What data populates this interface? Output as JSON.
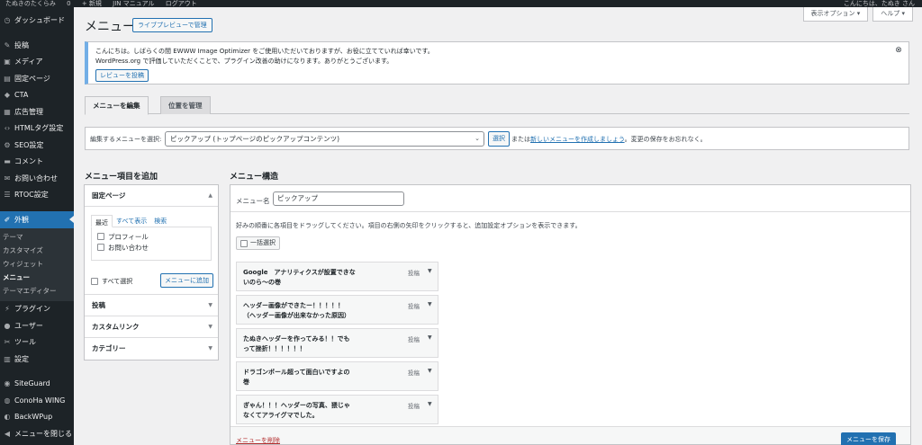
{
  "adminbar": {
    "items": [
      "たぬきのたくらみ",
      "0",
      "+ 新規",
      "JIN マニュアル",
      "ログアウト"
    ],
    "greeting": "こんにちは、たぬき さん"
  },
  "sidebar": {
    "dashboard": "ダッシュボード",
    "items": [
      {
        "label": "投稿",
        "icon": "pin-icon",
        "glyph": "✎"
      },
      {
        "label": "メディア",
        "icon": "media-icon",
        "glyph": "▣"
      },
      {
        "label": "固定ページ",
        "icon": "page-icon",
        "glyph": "▤"
      },
      {
        "label": "CTA",
        "icon": "cta-icon",
        "glyph": "◆"
      },
      {
        "label": "広告管理",
        "icon": "ads-icon",
        "glyph": "▦"
      },
      {
        "label": "HTMLタグ設定",
        "icon": "code-icon",
        "glyph": "‹›"
      },
      {
        "label": "SEO設定",
        "icon": "gear-icon",
        "glyph": "⚙"
      },
      {
        "label": "コメント",
        "icon": "comment-icon",
        "glyph": "▬"
      },
      {
        "label": "お問い合わせ",
        "icon": "mail-icon",
        "glyph": "✉"
      },
      {
        "label": "RTOC設定",
        "icon": "list-icon",
        "glyph": "☰"
      }
    ],
    "appearance": "外観",
    "sub_items": [
      "テーマ",
      "カスタマイズ",
      "ウィジェット",
      "メニュー",
      "テーマエディター"
    ],
    "items2": [
      {
        "label": "プラグイン",
        "icon": "plugin-icon",
        "glyph": "⚡"
      },
      {
        "label": "ユーザー",
        "icon": "user-icon",
        "glyph": "●"
      },
      {
        "label": "ツール",
        "icon": "tool-icon",
        "glyph": "✂"
      },
      {
        "label": "設定",
        "icon": "settings-icon",
        "glyph": "▥"
      }
    ],
    "items3": [
      {
        "label": "SiteGuard",
        "icon": "siteguard-icon",
        "glyph": "◉"
      },
      {
        "label": "ConoHa WING",
        "icon": "conoha-icon",
        "glyph": "◍"
      },
      {
        "label": "BackWPup",
        "icon": "backwpup-icon",
        "glyph": "◐"
      }
    ],
    "collapse": "メニューを閉じる"
  },
  "screen_tabs": {
    "options": "表示オプション ▾",
    "help": "ヘルプ ▾"
  },
  "page": {
    "title": "メニュー",
    "live_preview": "ライブプレビューで管理"
  },
  "notice": {
    "line1": "こんにちは。しばらくの間 EWWW Image Optimizer をご使用いただいておりますが、お役に立てていれば幸いです。",
    "line2": "WordPress.org で評価していただくことで、プラグイン改善の助けになります。ありがとうございます。",
    "button": "レビューを投稿"
  },
  "tabs": {
    "edit": "メニューを編集",
    "locations": "位置を管理"
  },
  "select_bar": {
    "label": "編集するメニューを選択:",
    "selected": "ピックアップ (トップページのピックアップコンテンツ)",
    "button": "選択",
    "or": "または",
    "create_link": "新しいメニューを作成しましょう",
    "suffix": "。変更の保存をお忘れなく。"
  },
  "add_items": {
    "heading": "メニュー項目を追加",
    "pages_heading": "固定ページ",
    "inner_tabs": [
      "最近",
      "すべて表示",
      "検索"
    ],
    "pages": [
      "プロフィール",
      "お問い合わせ"
    ],
    "select_all": "すべて選択",
    "add_button": "メニューに追加",
    "sections": [
      "投稿",
      "カスタムリンク",
      "カテゴリー"
    ]
  },
  "structure": {
    "heading": "メニュー構造",
    "name_label": "メニュー名",
    "name_value": "ピックアップ",
    "instructions": "好みの順番に各項目をドラッグしてください。項目の右側の矢印をクリックすると、追加設定オプションを表示できます。",
    "bulk_select": "一括選択",
    "items": [
      {
        "title": "Google　アナリティクスが設置できないのら〜の巻",
        "type": "投稿"
      },
      {
        "title": "ヘッダー画像ができたー！！！！！（ヘッダー画像が出来なかった原因）",
        "type": "投稿"
      },
      {
        "title": "たぬきヘッダーを作ってみる！！でもって挫折！！！！！！",
        "type": "投稿"
      },
      {
        "title": "ドラゴンボール超って面白いですよの巻",
        "type": "投稿"
      },
      {
        "title": "ぎゃん！！！ヘッダーの写真、猥じゃなくてアライグマでした。",
        "type": "投稿"
      }
    ],
    "delete": "メニューを削除",
    "save": "メニューを保存"
  }
}
